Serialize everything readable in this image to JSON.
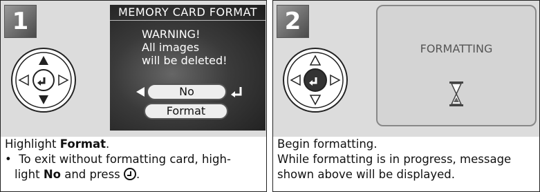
{
  "step1": {
    "number": "1",
    "screen_title": "MEMORY CARD FORMAT",
    "warning_lines": [
      "WARNING!",
      "All images",
      "will be deleted!"
    ],
    "options": [
      "No",
      "Format"
    ],
    "caption_prefix": "Highlight ",
    "caption_bold": "Format",
    "caption_suffix": ".",
    "bullet_char": "•",
    "bullet_line1": "To exit without formatting card, high-",
    "bullet_line2_prefix": "light ",
    "bullet_line2_bold": "No",
    "bullet_line2_suffix": " and press "
  },
  "step2": {
    "number": "2",
    "screen_label": "FORMATTING",
    "caption_line1": "Begin formatting.",
    "caption_line2": "While formatting is in progress, message",
    "caption_line3": "shown above will be displayed."
  },
  "colors": {
    "panel_gray": "#dcdcdc",
    "screen_dark": "#2a2a2a",
    "border": "#222222"
  },
  "icons": [
    "multi-selector-icon",
    "enter-button-icon",
    "hourglass-icon"
  ]
}
